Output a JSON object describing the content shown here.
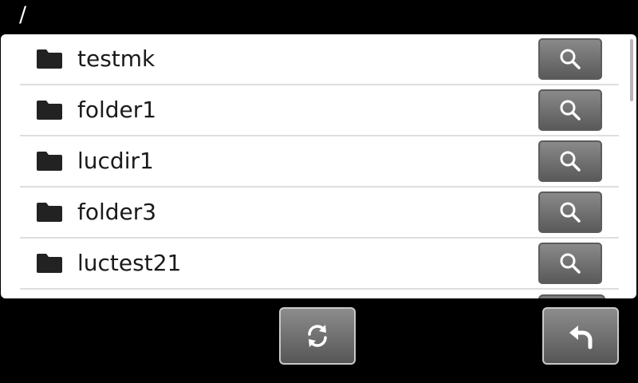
{
  "header": {
    "path": "/"
  },
  "file_list": {
    "items": [
      {
        "name": "testmk",
        "icon": "folder-icon",
        "action_icon": "search-icon"
      },
      {
        "name": "folder1",
        "icon": "folder-icon",
        "action_icon": "search-icon"
      },
      {
        "name": "lucdir1",
        "icon": "folder-icon",
        "action_icon": "search-icon"
      },
      {
        "name": "folder3",
        "icon": "folder-icon",
        "action_icon": "search-icon"
      },
      {
        "name": "luctest21",
        "icon": "folder-icon",
        "action_icon": "search-icon"
      }
    ]
  },
  "footer": {
    "refresh_icon": "refresh-icon",
    "back_icon": "back-arrow-icon"
  },
  "colors": {
    "background": "#000000",
    "panel": "#ffffff",
    "button_top": "#8a8a8a",
    "button_bottom": "#5a5a5a",
    "text": "#1a1a1a"
  }
}
